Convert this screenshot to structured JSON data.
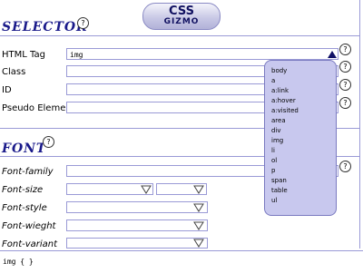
{
  "logo": {
    "top": "CSS",
    "bottom": "GIZMO"
  },
  "selector": {
    "title": "SELECTOR",
    "html_tag_label": "HTML Tag",
    "html_tag_value": "img",
    "class_label": "Class",
    "id_label": "ID",
    "pseudo_label": "Pseudo Element"
  },
  "font": {
    "title": "FONT",
    "family_label": "Font-family",
    "size_label": "Font-size",
    "style_label": "Font-style",
    "weight_label": "Font-wieght",
    "variant_label": "Font-variant"
  },
  "help_glyph": "?",
  "dropdown": {
    "items": [
      "body",
      "a",
      "a:link",
      "a:hover",
      "a:visited",
      "area",
      "div",
      "img",
      "li",
      "ol",
      "p",
      "span",
      "table",
      "ul"
    ]
  },
  "status": {
    "text": "img { }"
  },
  "colors": {
    "accent": "#1a1a8a",
    "border": "#9a9ad6",
    "dropdown_bg": "#c8c8ee"
  }
}
